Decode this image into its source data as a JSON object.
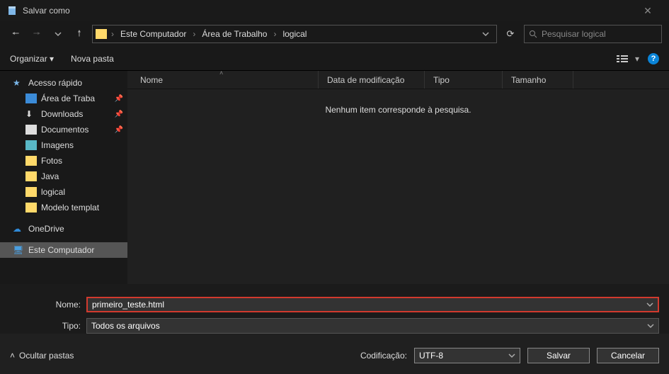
{
  "window": {
    "title": "Salvar como"
  },
  "breadcrumb": [
    "Este Computador",
    "Área de Trabalho",
    "logical"
  ],
  "search": {
    "placeholder": "Pesquisar logical"
  },
  "toolbar": {
    "organize": "Organizar",
    "newfolder": "Nova pasta"
  },
  "columns": {
    "name": "Nome",
    "modified": "Data de modificação",
    "type": "Tipo",
    "size": "Tamanho"
  },
  "empty_msg": "Nenhum item corresponde à pesquisa.",
  "sidebar": {
    "quick": "Acesso rápido",
    "items": [
      {
        "label": "Área de Trabalho",
        "ico": "desk",
        "pin": true,
        "trunc": "Área de Traba"
      },
      {
        "label": "Downloads",
        "ico": "dl",
        "pin": true
      },
      {
        "label": "Documentos",
        "ico": "doc",
        "pin": true
      },
      {
        "label": "Imagens",
        "ico": "img",
        "pin": false
      },
      {
        "label": "Fotos",
        "ico": "fld",
        "pin": false
      },
      {
        "label": "Java",
        "ico": "fld",
        "pin": false
      },
      {
        "label": "logical",
        "ico": "fld",
        "pin": false
      },
      {
        "label": "Modelo template",
        "ico": "fld",
        "pin": false,
        "trunc": "Modelo templat"
      }
    ],
    "onedrive": "OneDrive",
    "thispc": "Este Computador"
  },
  "form": {
    "name_label": "Nome:",
    "name_value": "primeiro_teste.html",
    "type_label": "Tipo:",
    "type_value": "Todos os arquivos"
  },
  "footer": {
    "hide": "Ocultar pastas",
    "encoding_label": "Codificação:",
    "encoding_value": "UTF-8",
    "save": "Salvar",
    "cancel": "Cancelar"
  }
}
